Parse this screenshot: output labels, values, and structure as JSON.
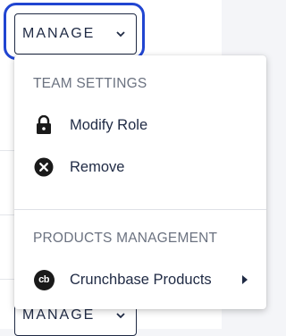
{
  "manage_button": {
    "label": "MANAGE"
  },
  "manage_button_secondary": {
    "label": "MANAGE"
  },
  "menu": {
    "team_settings": {
      "title": "TEAM SETTINGS",
      "items": [
        {
          "label": "Modify Role",
          "icon": "lock-icon"
        },
        {
          "label": "Remove",
          "icon": "close-circle-icon"
        }
      ]
    },
    "products_management": {
      "title": "PRODUCTS MANAGEMENT",
      "items": [
        {
          "label": "Crunchbase Products",
          "icon": "crunchbase-logo-icon",
          "icon_text": "cb",
          "has_submenu": true
        }
      ]
    }
  },
  "colors": {
    "focus_ring": "#2145d1",
    "text_primary": "#1f2a44",
    "text_secondary": "#6b7280"
  }
}
